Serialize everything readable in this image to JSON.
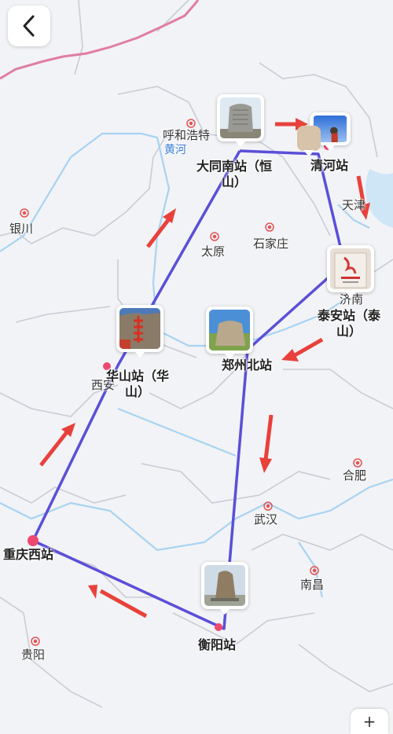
{
  "nav": {
    "back_icon": "chevron-left-icon"
  },
  "colors": {
    "route": "#5b4fd8",
    "arrow": "#e8413b",
    "border_pink": "#e07ea2",
    "river": "#a8d3f2",
    "province": "#c9ccd6",
    "city_dot": "#e45454",
    "station_dot": "#ef4870"
  },
  "rivers": {
    "huanghe": "黄河"
  },
  "cities": {
    "hohhot": "呼和浩特",
    "yinchuan": "银川",
    "tianjin": "天津",
    "taiyuan": "太原",
    "shijiazhuang": "石家庄",
    "jinan": "济南",
    "xian": "西安",
    "hefei": "合肥",
    "wuhan": "武汉",
    "nanchang": "南昌",
    "guiyang": "贵阳"
  },
  "stations": {
    "datong": {
      "line1": "大同南站（恒",
      "line2": "山）",
      "photo": "hengshan-stone-monument"
    },
    "qinghe": {
      "line1": "清河站",
      "photo": "beijing-sunset-sky"
    },
    "taian": {
      "line1": "泰安站（泰",
      "line2": "山）",
      "photo": "taishan-stele"
    },
    "zhengzhou": {
      "line1": "郑州北站",
      "photo": "shaolin-stone"
    },
    "huashan": {
      "line1": "华山站（华",
      "line2": "山）",
      "photo": "huashan-red-inscription"
    },
    "chongqing": {
      "line1": "重庆西站"
    },
    "hengyang": {
      "line1": "衡阳站",
      "photo": "hengshan-rock"
    }
  },
  "bottom_control": {
    "symbol": "+"
  }
}
